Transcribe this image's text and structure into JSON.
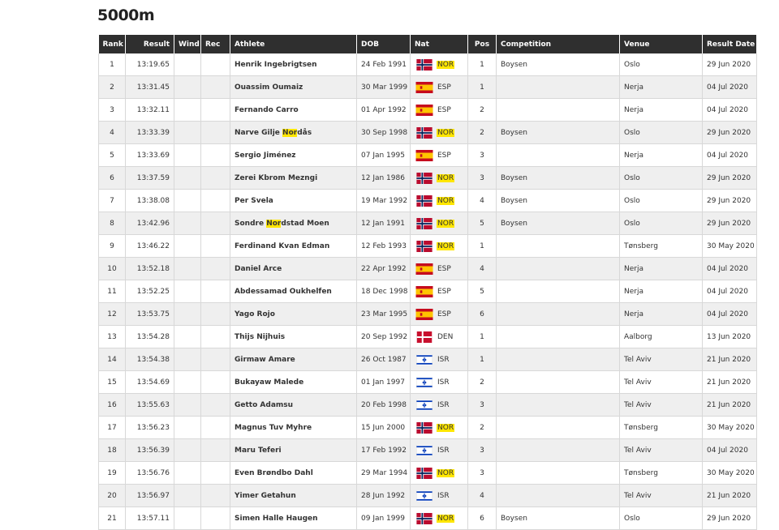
{
  "title": "5000m",
  "columns": {
    "rank": "Rank",
    "result": "Result",
    "wind": "Wind",
    "rec": "Rec",
    "athlete": "Athlete",
    "dob": "DOB",
    "nat": "Nat",
    "pos": "Pos",
    "competition": "Competition",
    "venue": "Venue",
    "result_date": "Result Date"
  },
  "flag_icons": {
    "NOR": "norway-flag-icon",
    "ESP": "spain-flag-icon",
    "DEN": "denmark-flag-icon",
    "ISR": "israel-flag-icon"
  },
  "highlight_color": "#ffe600",
  "rows": [
    {
      "rank": "1",
      "result": "13:19.65",
      "athlete": "Henrik Ingebrigtsen",
      "dob": "24 Feb 1991",
      "nat": "NOR",
      "nat_hl": true,
      "pos": "1",
      "competition": "Boysen",
      "venue": "Oslo",
      "date": "29 Jun 2020"
    },
    {
      "rank": "2",
      "result": "13:31.45",
      "athlete": "Ouassim Oumaiz",
      "dob": "30 Mar 1999",
      "nat": "ESP",
      "pos": "1",
      "competition": "",
      "venue": "Nerja",
      "date": "04 Jul 2020"
    },
    {
      "rank": "3",
      "result": "13:32.11",
      "athlete": "Fernando Carro",
      "dob": "01 Apr 1992",
      "nat": "ESP",
      "pos": "2",
      "competition": "",
      "venue": "Nerja",
      "date": "04 Jul 2020"
    },
    {
      "rank": "4",
      "result": "13:33.39",
      "athlete": "Narve Gilje Nordås",
      "name_pre": "Narve Gilje ",
      "name_hl": "Nor",
      "name_post": "dås",
      "dob": "30 Sep 1998",
      "nat": "NOR",
      "nat_hl": true,
      "pos": "2",
      "competition": "Boysen",
      "venue": "Oslo",
      "date": "29 Jun 2020"
    },
    {
      "rank": "5",
      "result": "13:33.69",
      "athlete": "Sergio Jiménez",
      "dob": "07 Jan 1995",
      "nat": "ESP",
      "pos": "3",
      "competition": "",
      "venue": "Nerja",
      "date": "04 Jul 2020"
    },
    {
      "rank": "6",
      "result": "13:37.59",
      "athlete": "Zerei Kbrom Mezngi",
      "dob": "12 Jan 1986",
      "nat": "NOR",
      "nat_hl": true,
      "pos": "3",
      "competition": "Boysen",
      "venue": "Oslo",
      "date": "29 Jun 2020"
    },
    {
      "rank": "7",
      "result": "13:38.08",
      "athlete": "Per Svela",
      "dob": "19 Mar 1992",
      "nat": "NOR",
      "nat_hl": true,
      "pos": "4",
      "competition": "Boysen",
      "venue": "Oslo",
      "date": "29 Jun 2020"
    },
    {
      "rank": "8",
      "result": "13:42.96",
      "athlete": "Sondre Nordstad Moen",
      "name_pre": "Sondre ",
      "name_hl": "Nor",
      "name_post": "dstad Moen",
      "dob": "12 Jan 1991",
      "nat": "NOR",
      "nat_hl": true,
      "pos": "5",
      "competition": "Boysen",
      "venue": "Oslo",
      "date": "29 Jun 2020"
    },
    {
      "rank": "9",
      "result": "13:46.22",
      "athlete": "Ferdinand Kvan Edman",
      "dob": "12 Feb 1993",
      "nat": "NOR",
      "nat_hl": true,
      "pos": "1",
      "competition": "",
      "venue": "Tønsberg",
      "date": "30 May 2020"
    },
    {
      "rank": "10",
      "result": "13:52.18",
      "athlete": "Daniel Arce",
      "dob": "22 Apr 1992",
      "nat": "ESP",
      "pos": "4",
      "competition": "",
      "venue": "Nerja",
      "date": "04 Jul 2020"
    },
    {
      "rank": "11",
      "result": "13:52.25",
      "athlete": "Abdessamad Oukhelfen",
      "dob": "18 Dec 1998",
      "nat": "ESP",
      "pos": "5",
      "competition": "",
      "venue": "Nerja",
      "date": "04 Jul 2020"
    },
    {
      "rank": "12",
      "result": "13:53.75",
      "athlete": "Yago Rojo",
      "dob": "23 Mar 1995",
      "nat": "ESP",
      "pos": "6",
      "competition": "",
      "venue": "Nerja",
      "date": "04 Jul 2020"
    },
    {
      "rank": "13",
      "result": "13:54.28",
      "athlete": "Thijs Nijhuis",
      "dob": "20 Sep 1992",
      "nat": "DEN",
      "pos": "1",
      "competition": "",
      "venue": "Aalborg",
      "date": "13 Jun 2020"
    },
    {
      "rank": "14",
      "result": "13:54.38",
      "athlete": "Girmaw Amare",
      "dob": "26 Oct 1987",
      "nat": "ISR",
      "pos": "1",
      "competition": "",
      "venue": "Tel Aviv",
      "date": "21 Jun 2020"
    },
    {
      "rank": "15",
      "result": "13:54.69",
      "athlete": "Bukayaw Malede",
      "dob": "01 Jan 1997",
      "nat": "ISR",
      "pos": "2",
      "competition": "",
      "venue": "Tel Aviv",
      "date": "21 Jun 2020"
    },
    {
      "rank": "16",
      "result": "13:55.63",
      "athlete": "Getto Adamsu",
      "dob": "20 Feb 1998",
      "nat": "ISR",
      "pos": "3",
      "competition": "",
      "venue": "Tel Aviv",
      "date": "21 Jun 2020"
    },
    {
      "rank": "17",
      "result": "13:56.23",
      "athlete": "Magnus Tuv Myhre",
      "dob": "15 Jun 2000",
      "nat": "NOR",
      "nat_hl": true,
      "pos": "2",
      "competition": "",
      "venue": "Tønsberg",
      "date": "30 May 2020"
    },
    {
      "rank": "18",
      "result": "13:56.39",
      "athlete": "Maru Teferi",
      "dob": "17 Feb 1992",
      "nat": "ISR",
      "pos": "3",
      "competition": "",
      "venue": "Tel Aviv",
      "date": "04 Jul 2020"
    },
    {
      "rank": "19",
      "result": "13:56.76",
      "athlete": "Even Brøndbo Dahl",
      "dob": "29 Mar 1994",
      "nat": "NOR",
      "nat_hl": true,
      "pos": "3",
      "competition": "",
      "venue": "Tønsberg",
      "date": "30 May 2020"
    },
    {
      "rank": "20",
      "result": "13:56.97",
      "athlete": "Yimer Getahun",
      "dob": "28 Jun 1992",
      "nat": "ISR",
      "pos": "4",
      "competition": "",
      "venue": "Tel Aviv",
      "date": "21 Jun 2020"
    },
    {
      "rank": "21",
      "result": "13:57.11",
      "athlete": "Simen Halle Haugen",
      "dob": "09 Jan 1999",
      "nat": "NOR",
      "nat_hl": true,
      "pos": "6",
      "competition": "Boysen",
      "venue": "Oslo",
      "date": "29 Jun 2020"
    }
  ]
}
